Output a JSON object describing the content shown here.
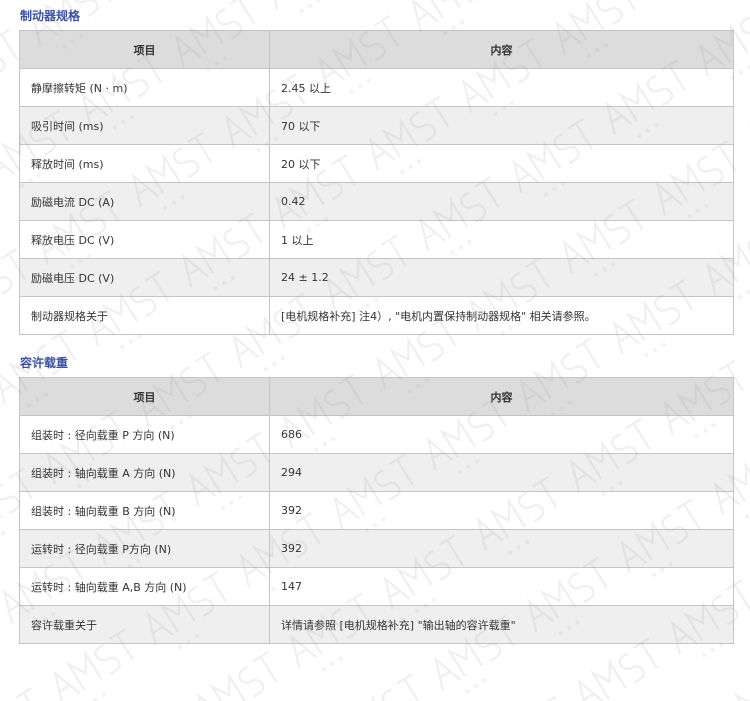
{
  "brake_section": {
    "title": "制动器规格",
    "header": {
      "item": "项目",
      "content": "内容"
    },
    "rows": [
      {
        "item": "静摩擦转矩 (N · m)",
        "value": "2.45 以上"
      },
      {
        "item": "吸引时间 (ms)",
        "value": "70 以下"
      },
      {
        "item": "释放时间 (ms)",
        "value": "20 以下"
      },
      {
        "item": "励磁电流 DC (A)",
        "value": "0.42"
      },
      {
        "item": "释放电压 DC (V)",
        "value": "1 以上"
      },
      {
        "item": "励磁电压 DC (V)",
        "value": "24 ± 1.2"
      },
      {
        "item": "制动器规格关于",
        "value": "[电机规格补充] 注4）, \"电机内置保持制动器规格\" 相关请参照。"
      }
    ]
  },
  "load_section": {
    "title": "容许载重",
    "header": {
      "item": "项目",
      "content": "内容"
    },
    "rows": [
      {
        "item": "组装时 : 径向载重 P 方向 (N)",
        "value": "686"
      },
      {
        "item": "组装时 : 轴向载重 A 方向 (N)",
        "value": "294"
      },
      {
        "item": "组装时 : 轴向载重 B 方向 (N)",
        "value": "392"
      },
      {
        "item": "运转时 : 径向载重 P方向 (N)",
        "value": "392"
      },
      {
        "item": "运转时 : 轴向载重 A,B 方向 (N)",
        "value": "147"
      },
      {
        "item": "容许载重关于",
        "value": "详情请参照 [电机规格补充] \"输出轴的容许载重\""
      }
    ]
  },
  "colors": {
    "section_title": "#3a4fa0",
    "header_bg": "#dcdcdc",
    "row_alt_bg": "#efefef",
    "border": "#c4c4c4"
  }
}
